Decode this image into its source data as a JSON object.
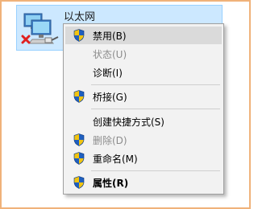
{
  "network_item": {
    "title": "以太网",
    "icon": "network-adapter-disconnected-icon"
  },
  "context_menu": {
    "items": [
      {
        "label": "禁用(B)",
        "shield": true,
        "disabled": false,
        "highlighted": true,
        "bold": false
      },
      {
        "label": "状态(U)",
        "shield": false,
        "disabled": true,
        "highlighted": false,
        "bold": false
      },
      {
        "label": "诊断(I)",
        "shield": false,
        "disabled": false,
        "highlighted": false,
        "bold": false
      },
      {
        "label": "桥接(G)",
        "shield": true,
        "disabled": false,
        "highlighted": false,
        "bold": false
      },
      {
        "label": "创建快捷方式(S)",
        "shield": false,
        "disabled": false,
        "highlighted": false,
        "bold": false
      },
      {
        "label": "删除(D)",
        "shield": true,
        "disabled": true,
        "highlighted": false,
        "bold": false
      },
      {
        "label": "重命名(M)",
        "shield": true,
        "disabled": false,
        "highlighted": false,
        "bold": false
      },
      {
        "label": "属性(R)",
        "shield": true,
        "disabled": false,
        "highlighted": false,
        "bold": true
      }
    ]
  },
  "colors": {
    "selection_bg": "#cce8ff",
    "menu_bg": "#f2f2f2",
    "menu_highlight": "#dadada",
    "disabled_text": "#8c8c8c",
    "frame_border": "#f0b27a"
  }
}
